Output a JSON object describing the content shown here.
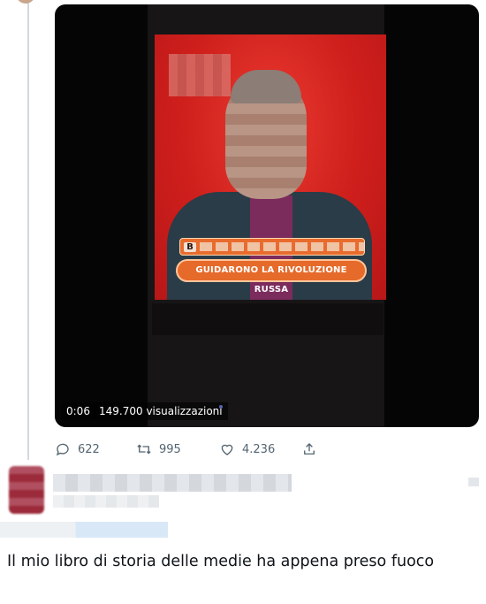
{
  "video": {
    "time": "0:06",
    "views": "149.700 visualizzazioni",
    "on_screen_letter": "B",
    "on_screen_clue": "GUIDARONO LA RIVOLUZIONE RUSSA"
  },
  "actions": {
    "replies": "622",
    "retweets": "995",
    "likes": "4.236",
    "reply_icon": "comment-icon",
    "retweet_icon": "retweet-icon",
    "like_icon": "heart-icon",
    "share_icon": "share-icon"
  },
  "tweet": {
    "text": "Il mio libro di storia delle medie ha appena preso fuoco"
  },
  "colors": {
    "text_primary": "#0f1419",
    "text_secondary": "#536471",
    "thread_line": "#cfd9de",
    "screen_red": "#d72020",
    "clue_orange": "#e66a2a"
  }
}
